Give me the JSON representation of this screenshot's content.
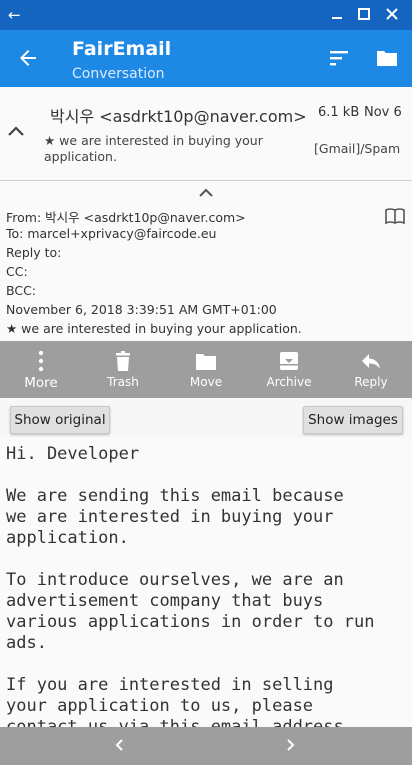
{
  "window": {
    "back_glyph": "←"
  },
  "app_bar": {
    "title": "FairEmail",
    "subtitle": "Conversation"
  },
  "message": {
    "sender": "박시우 <asdrkt10p@naver.com>",
    "size": "6.1 kB",
    "date": "Nov 6",
    "subject": "★ we are interested in buying your application.",
    "folder": "[Gmail]/Spam"
  },
  "details": {
    "from": "From:  박시우 <asdrkt10p@naver.com>",
    "to": "To:  marcel+xprivacy@faircode.eu",
    "reply_to": "Reply to:",
    "cc": "CC:",
    "bcc": "BCC:",
    "datetime": "November 6, 2018 3:39:51 AM GMT+01:00",
    "subject": "★ we are interested in buying your application."
  },
  "actions": [
    {
      "label": "More",
      "icon": "more-vert-icon"
    },
    {
      "label": "Trash",
      "icon": "trash-icon"
    },
    {
      "label": "Move",
      "icon": "folder-icon"
    },
    {
      "label": "Archive",
      "icon": "archive-icon"
    },
    {
      "label": "Reply",
      "icon": "reply-icon"
    }
  ],
  "buttons": {
    "show_original": "Show original",
    "show_images": "Show images"
  },
  "body": {
    "greeting": "Hi. Developer",
    "paragraphs": [
      "We are sending this email because\nwe are interested in buying your\napplication.",
      "To introduce ourselves, we are an\nadvertisement company that buys\nvarious applications in order to run\nads.",
      "If you are interested in selling\nyour application to us, please\ncontact us via this email address."
    ]
  },
  "colors": {
    "system_bar": "#1565c0",
    "app_bar": "#1e88e5",
    "action_bar": "#9e9e9e"
  }
}
